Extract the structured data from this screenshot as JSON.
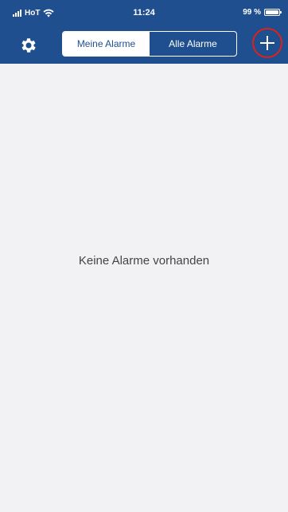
{
  "status_bar": {
    "carrier": "HoT",
    "time": "11:24",
    "battery": "99 %",
    "battery_level": 0.99,
    "icons": [
      "signal-icon",
      "wifi-icon",
      "battery-icon"
    ]
  },
  "nav": {
    "settings_icon": "gear-icon",
    "tabs": [
      {
        "label": "Meine Alarme",
        "active": true
      },
      {
        "label": "Alle Alarme",
        "active": false
      }
    ],
    "add_icon": "plus-icon",
    "highlight_color": "#e0201a"
  },
  "content": {
    "empty_message": "Keine Alarme vorhanden"
  },
  "colors": {
    "brand": "#1f4f8f",
    "background": "#f2f2f4"
  }
}
